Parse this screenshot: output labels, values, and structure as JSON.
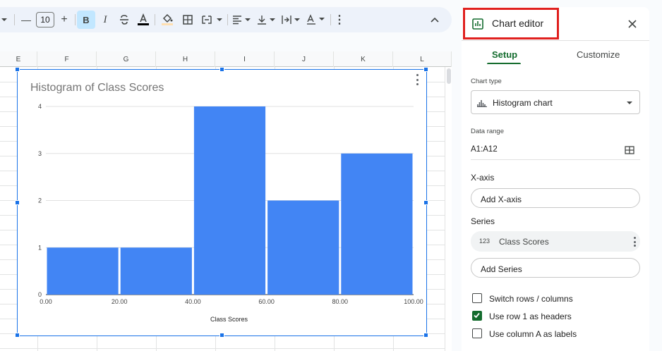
{
  "toolbar": {
    "font_size": "10",
    "minus_label": "—",
    "plus_label": "+",
    "bold_label": "B",
    "italic_label": "I",
    "more_label": "⋮",
    "collapse_label": "^"
  },
  "sheet": {
    "columns": [
      "E",
      "F",
      "G",
      "H",
      "I",
      "J",
      "K",
      "L"
    ]
  },
  "chart": {
    "menu_icon": "more-vert-icon"
  },
  "chart_data": {
    "type": "bar",
    "title": "Histogram of Class Scores",
    "xlabel": "Class Scores",
    "ylabel": "",
    "bins": [
      [
        0,
        20
      ],
      [
        20,
        40
      ],
      [
        40,
        60
      ],
      [
        60,
        80
      ],
      [
        80,
        100
      ]
    ],
    "values": [
      1,
      1,
      4,
      2,
      3
    ],
    "x_ticks": [
      "0.00",
      "20.00",
      "40.00",
      "60.00",
      "80.00",
      "100.00"
    ],
    "y_ticks": [
      "0",
      "1",
      "2",
      "3",
      "4"
    ],
    "xlim": [
      0,
      100
    ],
    "ylim": [
      0,
      4
    ],
    "bar_color": "#4285f4",
    "grid": true,
    "legend": "none"
  },
  "editor": {
    "title": "Chart editor",
    "tabs": {
      "setup": "Setup",
      "customize": "Customize"
    },
    "chart_type_label": "Chart type",
    "chart_type_value": "Histogram chart",
    "data_range_label": "Data range",
    "data_range_value": "A1:A12",
    "x_axis_label": "X-axis",
    "add_x_axis": "Add X-axis",
    "series_label": "Series",
    "series_num_icon": "123",
    "series_item": "Class Scores",
    "add_series": "Add Series",
    "checks": [
      {
        "label": "Switch rows / columns",
        "checked": false
      },
      {
        "label": "Use row 1 as headers",
        "checked": true
      },
      {
        "label": "Use column A as labels",
        "checked": false
      }
    ],
    "accent_color": "#146c2e",
    "highlight_color": "#e0201e"
  }
}
